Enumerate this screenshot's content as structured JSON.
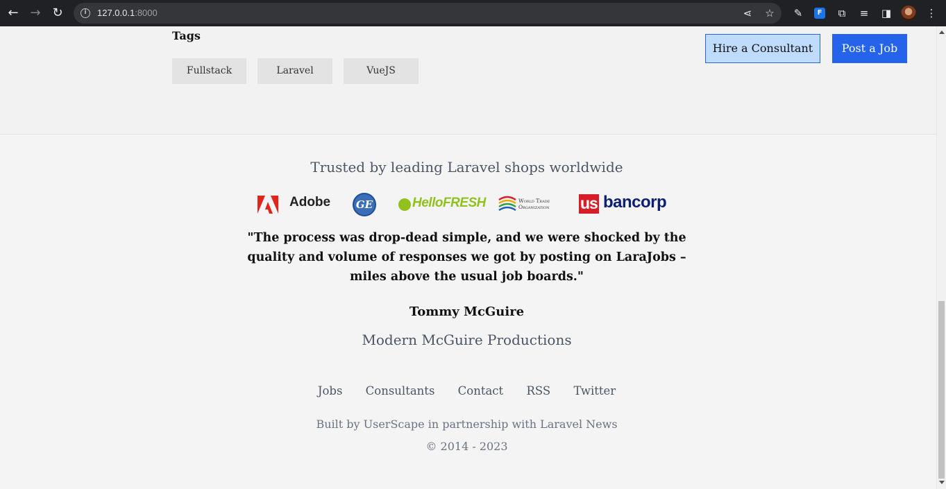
{
  "browser": {
    "url_host": "127.0.0.1",
    "url_port": ":8000"
  },
  "tags": {
    "title": "Tags",
    "items": [
      "Fullstack",
      "Laravel",
      "VueJS"
    ]
  },
  "actions": {
    "hire_label": "Hire a Consultant",
    "post_label": "Post a Job"
  },
  "trusted": {
    "heading": "Trusted by leading Laravel shops worldwide",
    "logos": {
      "adobe": "Adobe",
      "ge": "GE",
      "hellofresh": "HelloFRESH",
      "wto_line1": "World Trade",
      "wto_line2": "Organization",
      "usbank_us": "us",
      "usbank_rest": "bancorp"
    }
  },
  "testimonial": {
    "quote": "\"The process was drop-dead simple, and we were shocked by the quality and volume of responses we got by posting on LaraJobs – miles above the usual job boards.\"",
    "author": "Tommy McGuire",
    "company": "Modern McGuire Productions"
  },
  "footer": {
    "links": [
      "Jobs",
      "Consultants",
      "Contact",
      "RSS",
      "Twitter"
    ],
    "built_by": "Built by UserScape in partnership with Laravel News",
    "copyright": "© 2014 - 2023"
  },
  "colors": {
    "primary": "#2563eb",
    "primary_light": "#bfdbfe",
    "adobe_red": "#e1251b",
    "hellofresh_green": "#91c11e",
    "usbank_red": "#d71e28",
    "usbank_blue": "#0c2074"
  }
}
